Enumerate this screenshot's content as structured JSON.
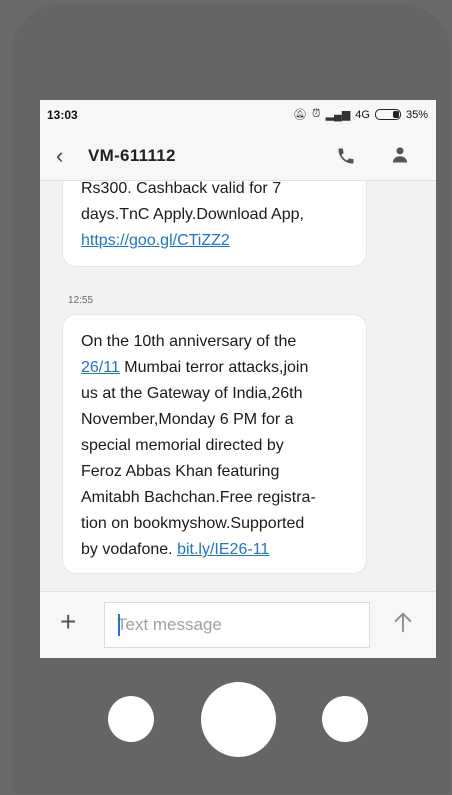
{
  "status_bar": {
    "time": "13:03",
    "network": "4G",
    "battery": "35%"
  },
  "header": {
    "contact": "VM-611112"
  },
  "messages": [
    {
      "lines": [
        "Rs300. Cashback valid for 7",
        "days.TnC Apply.Download App,"
      ],
      "link": "https://goo.gl/CTiZZ2"
    },
    {
      "time": "12:55",
      "line1": "On the 10th anniversary of the",
      "link1": "26/11",
      "line2_rest": " Mumbai terror attacks,join",
      "lines": [
        "us at the Gateway of India,26th",
        "November,Monday 6 PM for a",
        "special memorial directed by",
        "Feroz Abbas Khan featuring",
        "Amitabh Bachchan.Free registra-",
        "tion on bookmyshow.Supported"
      ],
      "last_prefix": "by vodafone. ",
      "link2": "bit.ly/IE26-11"
    }
  ],
  "composer": {
    "placeholder": "Text message"
  },
  "colors": {
    "link": "#1e74c9",
    "frame": "#656565"
  },
  "icons": [
    "back-icon",
    "call-icon",
    "person-icon",
    "add-icon",
    "send-icon",
    "mute-icon",
    "alarm-icon",
    "signal-icon",
    "battery-icon"
  ]
}
